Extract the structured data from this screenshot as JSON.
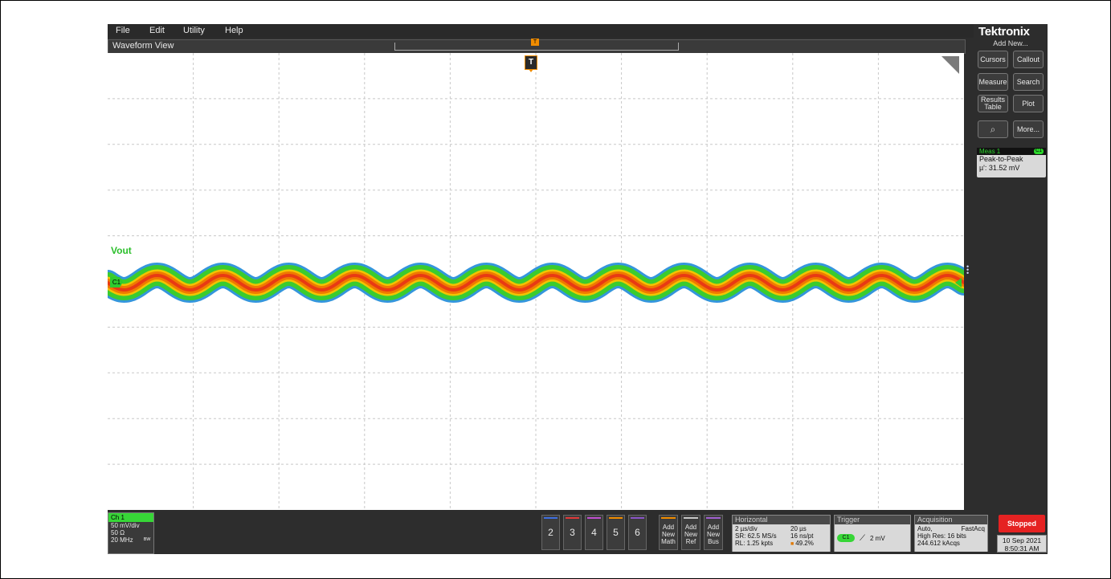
{
  "menu": [
    "File",
    "Edit",
    "Utility",
    "Help"
  ],
  "waveform_view": {
    "title": "Waveform View",
    "trigger_marker": "T",
    "channel_label": "Vout",
    "channel_marker": "C1",
    "cycles": 13,
    "colors": {
      "outer": "#1e8bd8",
      "mid": "#3acc2e",
      "inner1": "#f2c400",
      "inner2": "#f07a00",
      "core": "#e83a14"
    }
  },
  "sidebar": {
    "logo": "Tektronix",
    "add_new": "Add New...",
    "buttons": {
      "cursors": "Cursors",
      "callout": "Callout",
      "measure": "Measure",
      "search": "Search",
      "results_table_1": "Results",
      "results_table_2": "Table",
      "plot": "Plot",
      "more": "More..."
    },
    "measurement": {
      "name": "Meas 1",
      "badge": "C1",
      "type": "Peak-to-Peak",
      "value": "µ': 31.52 mV"
    }
  },
  "bottom": {
    "ch1": {
      "label": "Ch 1",
      "scale": "50 mV/div",
      "impedance": "50 Ω",
      "bandwidth": "20 MHz",
      "bw_icon": "bandwidth-limit-icon"
    },
    "channel_buttons": [
      {
        "label": "2",
        "color": "#3f6fe0"
      },
      {
        "label": "3",
        "color": "#e03a3a"
      },
      {
        "label": "4",
        "color": "#c04fd0"
      },
      {
        "label": "5",
        "color": "#f08c00"
      },
      {
        "label": "6",
        "color": "#8a55c8"
      }
    ],
    "add_buttons": [
      {
        "line1": "Add",
        "line2": "New",
        "line3": "Math",
        "color": "#f08c00"
      },
      {
        "line1": "Add",
        "line2": "New",
        "line3": "Ref",
        "color": "#c8c8c8"
      },
      {
        "line1": "Add",
        "line2": "New",
        "line3": "Bus",
        "color": "#a060d0"
      }
    ],
    "horizontal": {
      "title": "Horizontal",
      "scale": "2 µs/div",
      "duration": "20 µs",
      "sample_rate": "SR: 62.5 MS/s",
      "resolution": "16 ns/pt",
      "record_length": "RL: 1.25 kpts",
      "position": "49.2%"
    },
    "trigger": {
      "title": "Trigger",
      "source": "C1",
      "level": "2 mV"
    },
    "acquisition": {
      "title": "Acquisition",
      "mode": "Auto,",
      "fast": "FastAcq",
      "resolution": "High Res: 16 bits",
      "count": "244.612 kAcqs"
    },
    "status": "Stopped",
    "date": "10 Sep 2021",
    "time": "8:50:31 AM"
  }
}
